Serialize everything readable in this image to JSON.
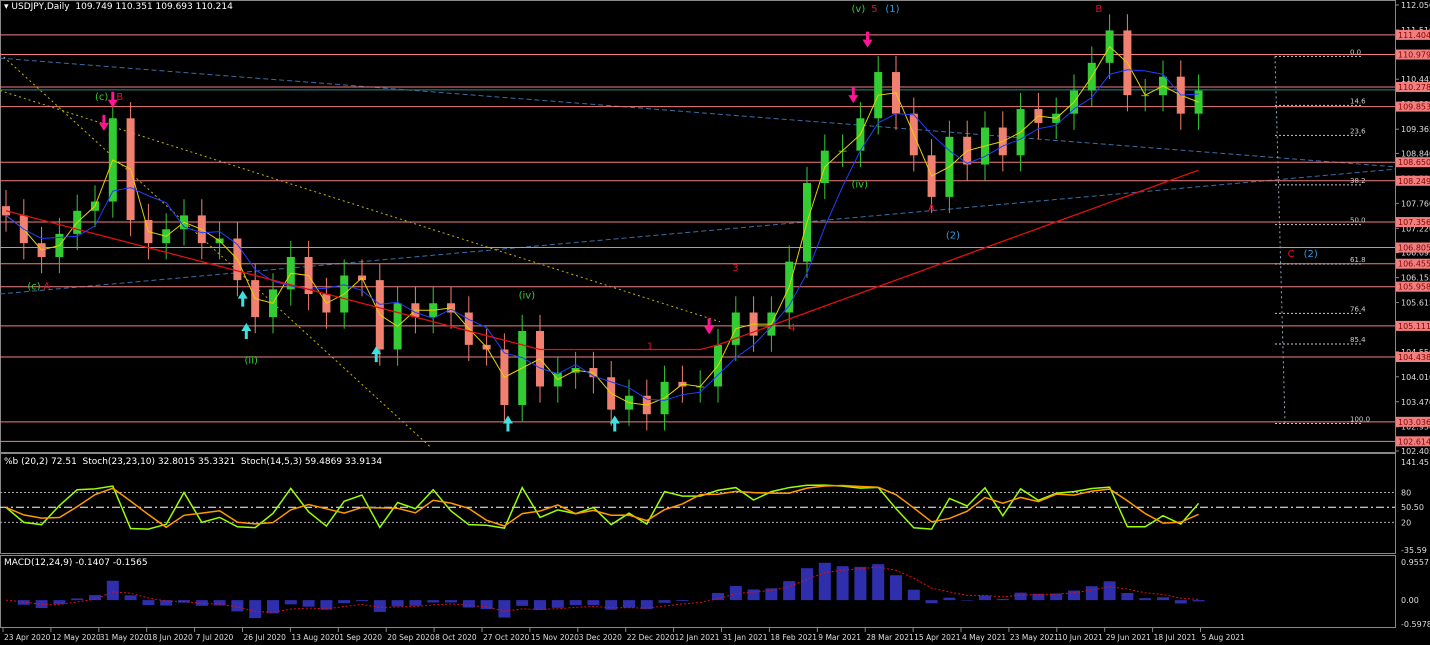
{
  "header": {
    "symbol": "USDJPY,Daily",
    "ohlc": "109.749 110.351 109.693 110.214"
  },
  "indicator_header": "%b (20,2) 72.51  Stoch(23,23,10) 32.8015 35.3321  Stoch(14,5,3) 59.4869 33.9134",
  "macd_header": "MACD(12,24,9) -0.1407 -0.1565",
  "colors": {
    "up": "#33cc33",
    "down": "#f08070",
    "ma_fast": "#e6d200",
    "ma_mid": "#1f3fff",
    "ma_slow": "#e01010",
    "level": "#f08080",
    "fib": "#c8c8c8",
    "pink_arrow": "#ff1493",
    "cyan_arrow": "#40e0e0",
    "stoch_main": "#9aff00",
    "stoch_sig": "#ff9900",
    "macd_hist": "#3b3bd9",
    "macd_sig": "#e01010"
  },
  "chart_data": {
    "type": "candlestick",
    "ylim": [
      102.405,
      112.05
    ],
    "price_ticks": [
      "112.050",
      "111.510",
      "110.980",
      "110.445",
      "109.905",
      "109.365",
      "108.840",
      "108.300",
      "107.760",
      "107.220",
      "106.695",
      "106.155",
      "105.615",
      "105.075",
      "104.550",
      "104.010",
      "103.470",
      "102.930",
      "102.405"
    ],
    "level_labels": [
      "111.404",
      "110.979",
      "110.278",
      "109.853",
      "108.650",
      "108.249",
      "107.356",
      "106.805",
      "106.455",
      "105.958",
      "105.111",
      "104.438",
      "103.036",
      "102.614"
    ],
    "current_price": "110.214",
    "fib_levels": [
      {
        "label": "0.0",
        "price": 110.94
      },
      {
        "label": "14.6",
        "price": 109.88
      },
      {
        "label": "23.6",
        "price": 109.23
      },
      {
        "label": "38.2",
        "price": 108.16
      },
      {
        "label": "50.0",
        "price": 107.3
      },
      {
        "label": "61.8",
        "price": 106.45
      },
      {
        "label": "76.4",
        "price": 105.38
      },
      {
        "label": "85.4",
        "price": 104.72
      },
      {
        "label": "100.0",
        "price": 103.0
      }
    ],
    "date_ticks": [
      "23 Apr 2020",
      "12 May 2020",
      "31 May 2020",
      "18 Jun 2020",
      "7 Jul 2020",
      "26 Jul 2020",
      "13 Aug 2020",
      "1 Sep 2020",
      "20 Sep 2020",
      "8 Oct 2020",
      "27 Oct 2020",
      "15 Nov 2020",
      "3 Dec 2020",
      "22 Dec 2020",
      "12 Jan 2021",
      "31 Jan 2021",
      "18 Feb 2021",
      "9 Mar 2021",
      "28 Mar 2021",
      "15 Apr 2021",
      "4 May 2021",
      "23 May 2021",
      "10 Jun 2021",
      "29 Jun 2021",
      "18 Jul 2021",
      "5 Aug 2021"
    ],
    "weekly_close": [
      107.5,
      106.9,
      106.6,
      107.1,
      107.6,
      107.8,
      109.6,
      107.4,
      106.9,
      107.2,
      107.5,
      106.9,
      107.0,
      106.1,
      105.3,
      105.9,
      106.6,
      105.8,
      105.4,
      106.2,
      106.1,
      104.6,
      105.6,
      105.3,
      105.6,
      105.4,
      104.7,
      104.6,
      103.4,
      105.0,
      103.8,
      104.1,
      104.2,
      104.0,
      103.3,
      103.6,
      103.2,
      103.9,
      103.8,
      103.8,
      104.7,
      105.4,
      104.9,
      105.4,
      106.5,
      108.2,
      108.9,
      108.9,
      109.6,
      110.6,
      109.7,
      108.8,
      107.9,
      109.2,
      108.6,
      109.4,
      108.8,
      109.8,
      109.5,
      109.7,
      110.2,
      110.8,
      111.5,
      110.1,
      110.1,
      110.5,
      109.7,
      110.2
    ],
    "annotations": [
      {
        "text": "(c)",
        "week": 5,
        "price": 110.0,
        "color": "#33cc33"
      },
      {
        "text": "B",
        "week": 6.2,
        "price": 110.0,
        "color": "#e01030"
      },
      {
        "text": "(c)",
        "week": 1.2,
        "price": 105.9,
        "color": "#33cc33"
      },
      {
        "text": "A",
        "week": 2.1,
        "price": 105.9,
        "color": "#e01030"
      },
      {
        "text": "(v)",
        "week": 47.5,
        "price": 111.9,
        "color": "#33cc33"
      },
      {
        "text": "5",
        "week": 48.6,
        "price": 111.9,
        "color": "#e01030"
      },
      {
        "text": "(1)",
        "week": 49.4,
        "price": 111.9,
        "color": "#3399dd"
      },
      {
        "text": "B",
        "week": 61.2,
        "price": 111.9,
        "color": "#e01030"
      },
      {
        "text": "A",
        "week": 51.8,
        "price": 107.6,
        "color": "#e01030"
      },
      {
        "text": "(2)",
        "week": 52.8,
        "price": 107.0,
        "color": "#3399dd"
      },
      {
        "text": "1",
        "week": 36,
        "price": 104.6,
        "color": "#e01030"
      },
      {
        "text": "3",
        "week": 40.8,
        "price": 106.3,
        "color": "#e01030"
      },
      {
        "text": "4",
        "week": 44,
        "price": 105.0,
        "color": "#e01030"
      },
      {
        "text": "(iv)",
        "week": 28.8,
        "price": 105.7,
        "color": "#33cc33"
      },
      {
        "text": "(ii)",
        "week": 13.4,
        "price": 104.3,
        "color": "#33cc33"
      },
      {
        "text": "(iv)",
        "week": 47.5,
        "price": 108.1,
        "color": "#33cc33"
      },
      {
        "text": "C",
        "week": 72,
        "price": 106.6,
        "color": "#e01030"
      },
      {
        "text": "(2)",
        "week": 72.9,
        "price": 106.6,
        "color": "#3399dd"
      }
    ],
    "arrows": [
      {
        "dir": "down",
        "week": 6,
        "price": 110.0
      },
      {
        "dir": "down",
        "week": 5.5,
        "price": 109.5
      },
      {
        "dir": "down",
        "week": 48.4,
        "price": 111.3
      },
      {
        "dir": "down",
        "week": 47.6,
        "price": 110.1
      },
      {
        "dir": "down",
        "week": 39.5,
        "price": 105.1
      },
      {
        "dir": "up",
        "week": 13.3,
        "price": 105.7
      },
      {
        "dir": "up",
        "week": 13.5,
        "price": 105.0
      },
      {
        "dir": "up",
        "week": 20.8,
        "price": 104.5
      },
      {
        "dir": "up",
        "week": 28.2,
        "price": 103.0
      },
      {
        "dir": "up",
        "week": 34.2,
        "price": 103.0
      }
    ],
    "osc_ticks": [
      "141.45",
      "80",
      "50.50",
      "20",
      "-35.59"
    ],
    "macd_ticks": [
      "0.9557",
      "0.00",
      "-0.5978"
    ]
  }
}
